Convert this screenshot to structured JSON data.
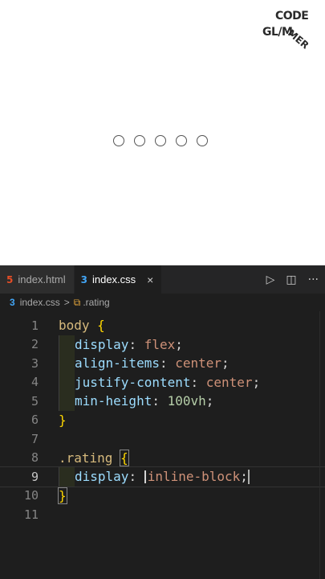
{
  "preview": {
    "logo": {
      "line1": "CODE",
      "line2": "GL/M",
      "line3": "MER"
    },
    "stars": [
      1,
      2,
      3,
      4,
      5
    ]
  },
  "tabs": [
    {
      "label": "index.html",
      "icon": "5",
      "active": false
    },
    {
      "label": "index.css",
      "icon": "3",
      "active": true,
      "close": "×"
    }
  ],
  "actions": {
    "run": "▷",
    "split": "◫",
    "more": "···"
  },
  "breadcrumb": {
    "file": "index.css",
    "icon": "3",
    "sep": ">",
    "symbol_icon": "⧉",
    "symbol": ".rating"
  },
  "code": {
    "line_numbers": [
      "1",
      "2",
      "3",
      "4",
      "5",
      "6",
      "7",
      "8",
      "9",
      "10",
      "11"
    ],
    "body": {
      "selector": "body",
      "open": "{",
      "p1": "display",
      "v1": "flex",
      "p2": "align-items",
      "v2": "center",
      "p3": "justify-content",
      "v3": "center",
      "p4": "min-height",
      "v4": "100vh",
      "close": "}"
    },
    "rating": {
      "selector": ".rating",
      "open": "{",
      "p1": "display",
      "v1": "inline-block",
      "close": "}"
    }
  },
  "colors": {
    "editor_bg": "#1e1e1e",
    "selector": "#d7ba7d",
    "property": "#9cdcfe",
    "value": "#ce9178",
    "number": "#b5cea8",
    "brace": "#ffd700"
  }
}
